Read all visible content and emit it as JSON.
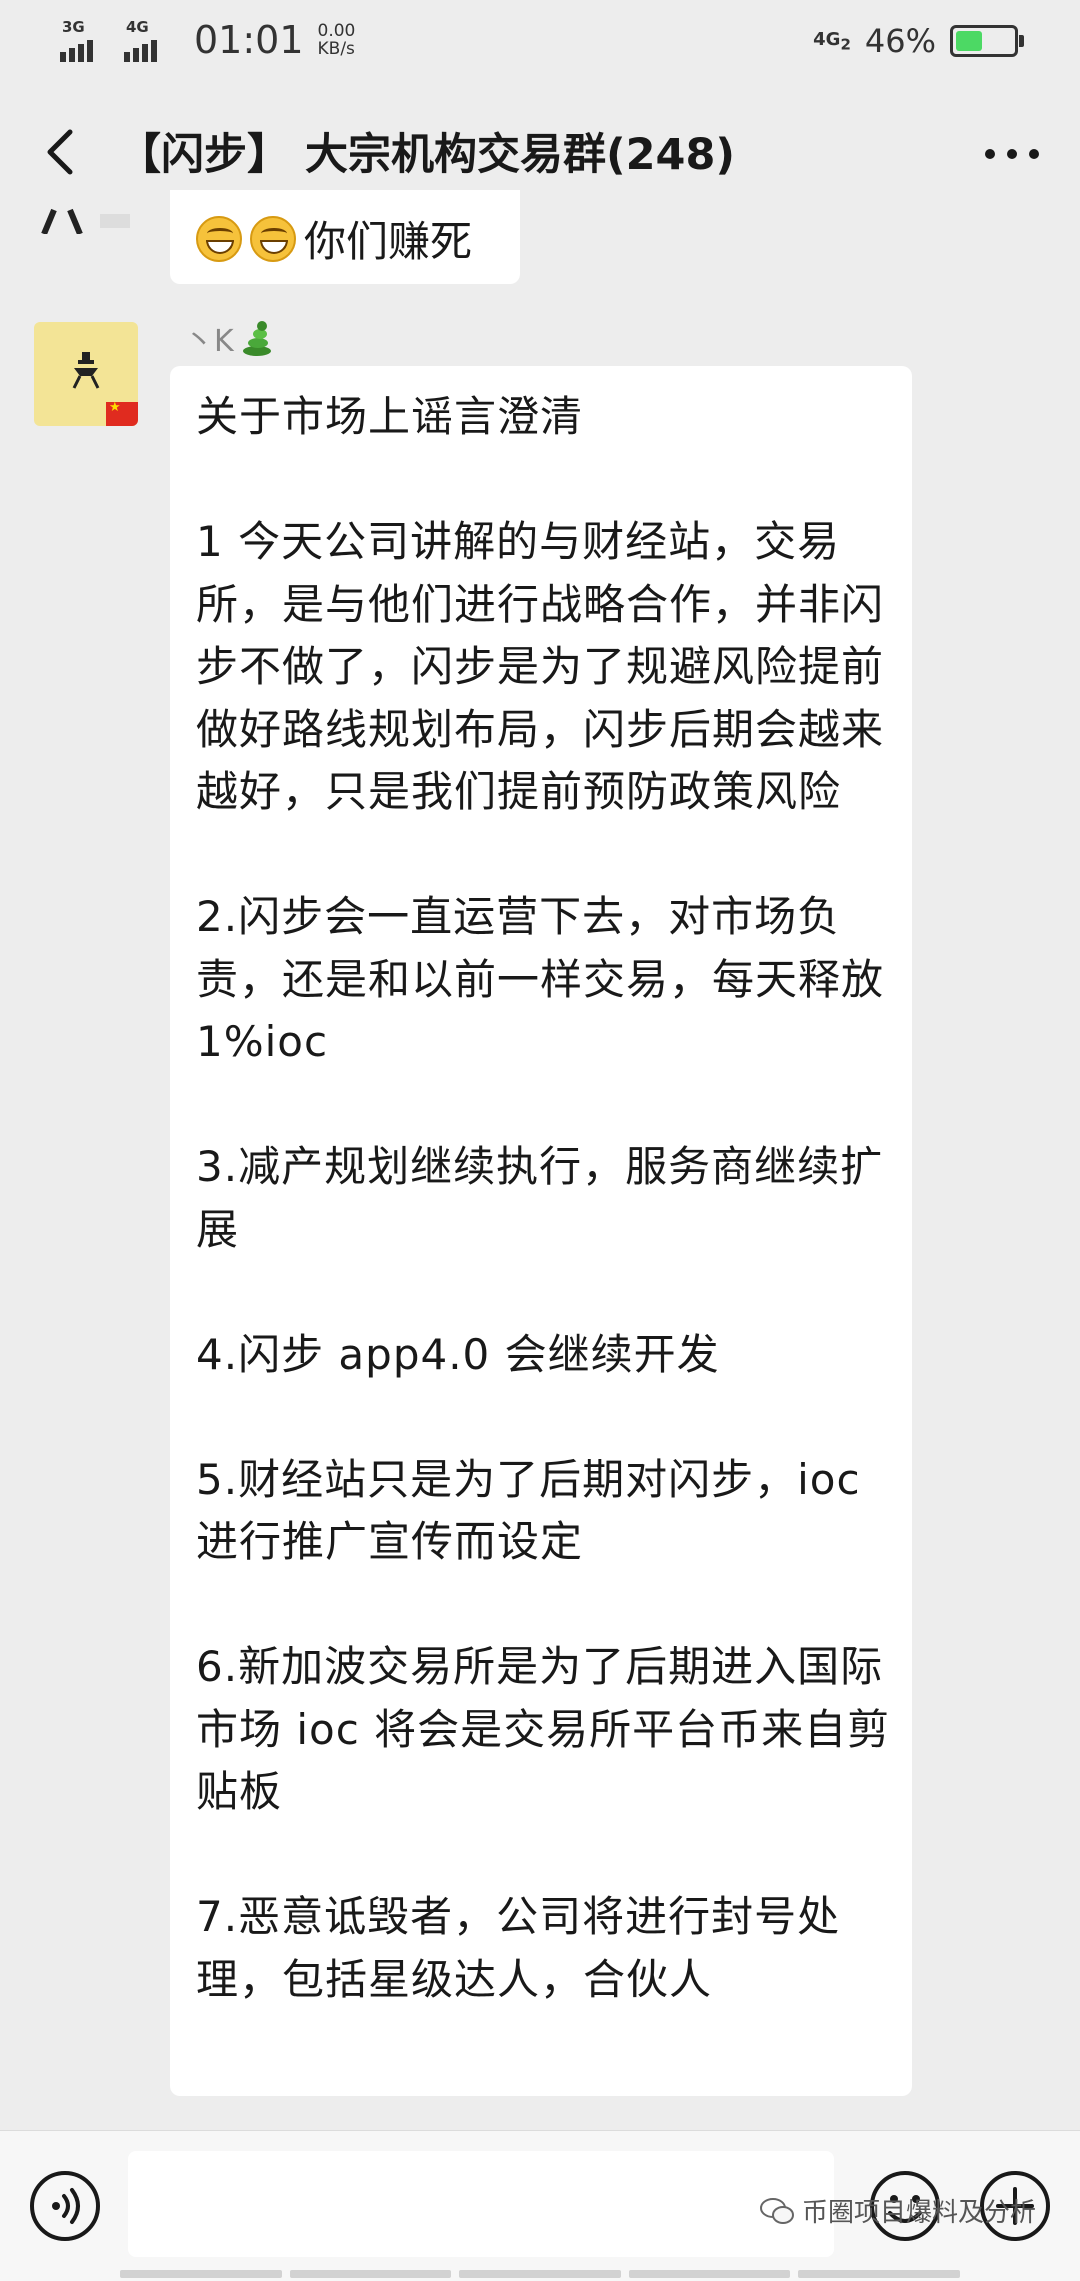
{
  "status": {
    "net1": "3G",
    "net2": "4G",
    "time": "01:01",
    "speed_value": "0.00",
    "speed_unit": "KB/s",
    "net_right": "4G",
    "net_right_sub": "2",
    "battery_percent": "46%",
    "battery_level": 0.46
  },
  "nav": {
    "title": "【闪步】 大宗机构交易群(248)",
    "back_icon": "chevron-left-icon",
    "more_icon": "more-dots-icon"
  },
  "messages": {
    "previous": {
      "emoji_icon": "grin-emoji-icon",
      "text": "你们赚死"
    },
    "current": {
      "sender_name": "丶K",
      "sender_badge_icon": "green-snake-icon",
      "text": "关于市场上谣言澄清\n\n1 今天公司讲解的与财经站，交易所，是与他们进行战略合作，并非闪步不做了，闪步是为了规避风险提前做好路线规划布局，闪步后期会越来越好，只是我们提前预防政策风险\n\n2.闪步会一直运营下去，对市场负责，还是和以前一样交易，每天释放 1%ioc\n\n3.减产规划继续执行，服务商继续扩展\n\n4.闪步 app4.0 会继续开发\n\n5.财经站只是为了后期对闪步，ioc进行推广宣传而设定\n\n6.新加波交易所是为了后期进入国际市场 ioc 将会是交易所平台币来自剪贴板\n\n7.恶意诋毁者，公司将进行封号处理，包括星级达人，合伙人"
    }
  },
  "input": {
    "voice_icon": "voice-icon",
    "text_value": "",
    "emoji_icon": "smiley-icon",
    "plus_icon": "plus-icon"
  },
  "watermark": {
    "icon": "wechat-icon",
    "text": "币圈项目爆料及分析"
  }
}
